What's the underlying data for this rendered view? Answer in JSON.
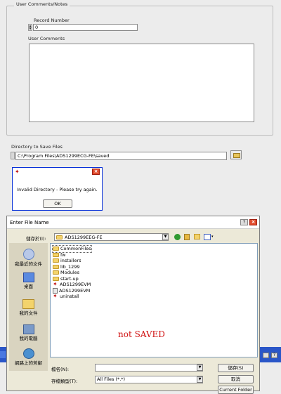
{
  "group": {
    "title": "User Comments/Notes"
  },
  "record": {
    "label": "Record Number",
    "value": "0"
  },
  "comments": {
    "label": "User Comments",
    "value": ""
  },
  "directory": {
    "label": "Directory to Save Files",
    "value": "C:\\Program Files\\ADS1299ECG-FE\\saved"
  },
  "error_dialog": {
    "message": "Invalid Directory - Please try again.",
    "ok_label": "OK"
  },
  "file_dialog": {
    "title": "Enter File Name",
    "save_in_label": "儲存於(I):",
    "save_in_value": "ADS1299EEG-FE",
    "places": [
      "我最近的文件",
      "桌面",
      "我的文件",
      "我的電腦",
      "網路上的芳鄰"
    ],
    "files": [
      {
        "name": "CommonFiles",
        "icon": "folder-icon"
      },
      {
        "name": "fw",
        "icon": "folder-icon"
      },
      {
        "name": "installers",
        "icon": "folder-icon"
      },
      {
        "name": "lib_1299",
        "icon": "folder-icon"
      },
      {
        "name": "Modules",
        "icon": "folder-icon"
      },
      {
        "name": "start-up",
        "icon": "folder-icon"
      },
      {
        "name": "ADS1299EVM",
        "icon": "ti-app-icon"
      },
      {
        "name": "ADS1299EVM",
        "icon": "config-file-icon"
      },
      {
        "name": "uninstall",
        "icon": "ti-app-icon"
      }
    ],
    "file_name_label": "檔名(N):",
    "file_name_value": "",
    "file_type_label": "存檔類型(T):",
    "file_type_value": "All Files (*.*)",
    "save_label": "儲存(S)",
    "cancel_label": "取消",
    "current_folder_label": "Current Folder"
  },
  "annotation": {
    "text": "not SAVED",
    "color": "#d01010"
  }
}
